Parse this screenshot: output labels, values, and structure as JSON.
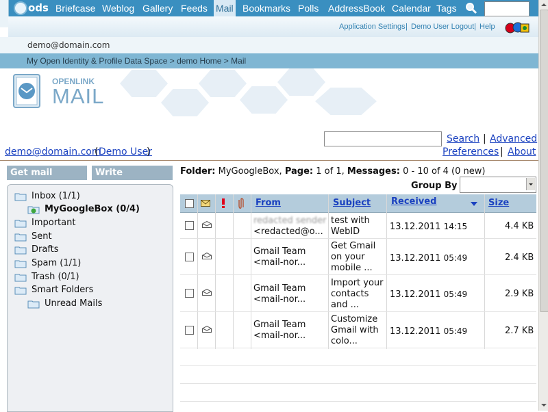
{
  "topnav": {
    "logo": "ods",
    "items": [
      "Briefcase",
      "Weblog",
      "Gallery",
      "Feeds",
      "Mail",
      "Bookmarks",
      "Polls",
      "AddressBook",
      "Calendar",
      "Tags"
    ],
    "active": "Mail"
  },
  "toplinks": {
    "settings": "Application Settings",
    "logout": "Demo User Logout",
    "help": "Help"
  },
  "user": {
    "email": "demo@domain.com",
    "name": "Demo User"
  },
  "breadcrumb": "My Open Identity & Profile Data Space > demo Home > Mail",
  "brand": {
    "top": "OPENLINK",
    "bottom": "MAIL"
  },
  "actions": {
    "search": "Search",
    "advanced": "Advanced",
    "preferences": "Preferences",
    "about": "About",
    "pipe": "|"
  },
  "left": {
    "get_mail": "Get mail",
    "write": "Write",
    "folders": [
      "Inbox (1/1)",
      "MyGoogleBox (0/4)",
      "Important",
      "Sent",
      "Drafts",
      "Spam (1/1)",
      "Trash (0/1)",
      "Smart Folders",
      "Unread Mails"
    ]
  },
  "folderinfo": {
    "folder_label": "Folder:",
    "folder": "MyGoogleBox,",
    "page_label": "Page:",
    "page": "1 of 1,",
    "messages_label": "Messages:",
    "messages": "0 - 10 of 4 (0 new)"
  },
  "groupby": {
    "label": "Group By",
    "value": ""
  },
  "table": {
    "columns": {
      "from": "From",
      "subject": "Subject",
      "received": "Received",
      "size": "Size"
    },
    "rows": [
      {
        "from1": "redacted sender",
        "from2": "<redacted@o...",
        "subject": [
          "test with",
          "WebID"
        ],
        "date": "13.12.2011",
        "time": "14:15",
        "size": "4.4 KB"
      },
      {
        "from1": "Gmail Team",
        "from2": "<mail-nor...",
        "subject": [
          "Get Gmail",
          "on your",
          "mobile ..."
        ],
        "date": "13.12.2011",
        "time": "05:49",
        "size": "2.4 KB"
      },
      {
        "from1": "Gmail Team",
        "from2": "<mail-nor...",
        "subject": [
          "Import your",
          "contacts",
          "and ..."
        ],
        "date": "13.12.2011",
        "time": "05:49",
        "size": "2.9 KB"
      },
      {
        "from1": "Gmail Team",
        "from2": "<mail-nor...",
        "subject": [
          "Customize",
          "Gmail with",
          "colo..."
        ],
        "date": "13.12.2011",
        "time": "05:49",
        "size": "2.7 KB"
      }
    ]
  }
}
